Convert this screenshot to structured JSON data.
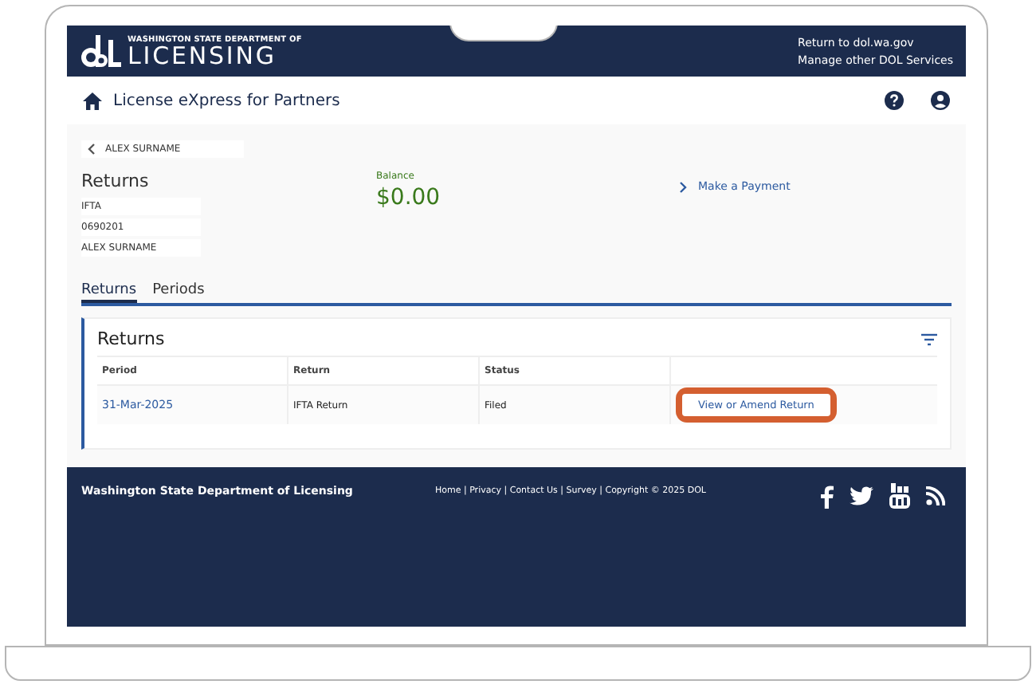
{
  "header": {
    "agency_line": "WASHINGTON STATE DEPARTMENT OF",
    "agency_name": "LICENSING",
    "links": [
      "Return to dol.wa.gov",
      "Manage other DOL Services"
    ]
  },
  "navbar": {
    "title": "License eXpress for Partners"
  },
  "breadcrumb": "ALEX SURNAME",
  "account": {
    "title": "Returns",
    "details": [
      "IFTA",
      "0690201",
      "ALEX SURNAME"
    ],
    "balance_label": "Balance",
    "balance": "$0.00",
    "payment_link": "Make a Payment"
  },
  "tabs": [
    {
      "label": "Returns",
      "selected": true
    },
    {
      "label": "Periods",
      "selected": false
    }
  ],
  "card": {
    "title": "Returns",
    "columns": [
      "Period",
      "Return",
      "Status"
    ],
    "rows": [
      {
        "period": "31-Mar-2025",
        "return": "IFTA Return",
        "status": "Filed",
        "action": "View or Amend Return",
        "highlighted": true
      }
    ]
  },
  "footer": {
    "agency": "Washington State Department of Licensing",
    "links": "Home | Privacy | Contact Us | Survey | Copyright © 2025 DOL"
  }
}
